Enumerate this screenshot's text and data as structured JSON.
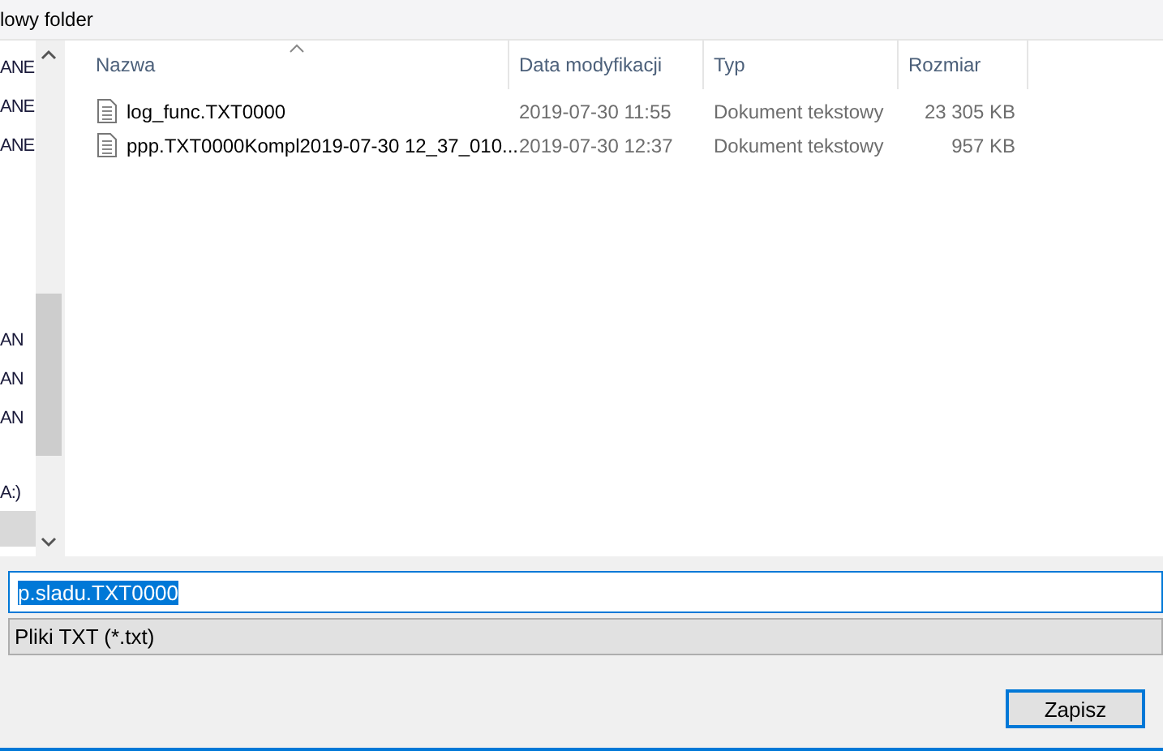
{
  "toolbar": {
    "new_folder": "lowy folder"
  },
  "nav": {
    "items": [
      {
        "label": "ANE",
        "selected": false
      },
      {
        "label": "ANE",
        "selected": false
      },
      {
        "label": "ANE",
        "selected": false
      },
      {
        "label": "AN",
        "selected": false
      },
      {
        "label": "AN",
        "selected": false
      },
      {
        "label": "AN",
        "selected": false
      },
      {
        "label": "A:)",
        "selected": false
      },
      {
        "selected": true
      }
    ]
  },
  "table": {
    "columns": [
      "Nazwa",
      "Data modyfikacji",
      "Typ",
      "Rozmiar"
    ],
    "rows": [
      {
        "name": "log_func.TXT0000",
        "date": "2019-07-30 11:55",
        "type": "Dokument tekstowy",
        "size": "23 305 KB"
      },
      {
        "name": "ppp.TXT0000Kompl2019-07-30 12_37_010...",
        "date": "2019-07-30 12:37",
        "type": "Dokument tekstowy",
        "size": "957 KB"
      }
    ]
  },
  "filename": {
    "value": "p.sladu.TXT0000"
  },
  "filetype": {
    "value": "Pliki TXT (*.txt)"
  },
  "buttons": [
    "Zapisz"
  ]
}
